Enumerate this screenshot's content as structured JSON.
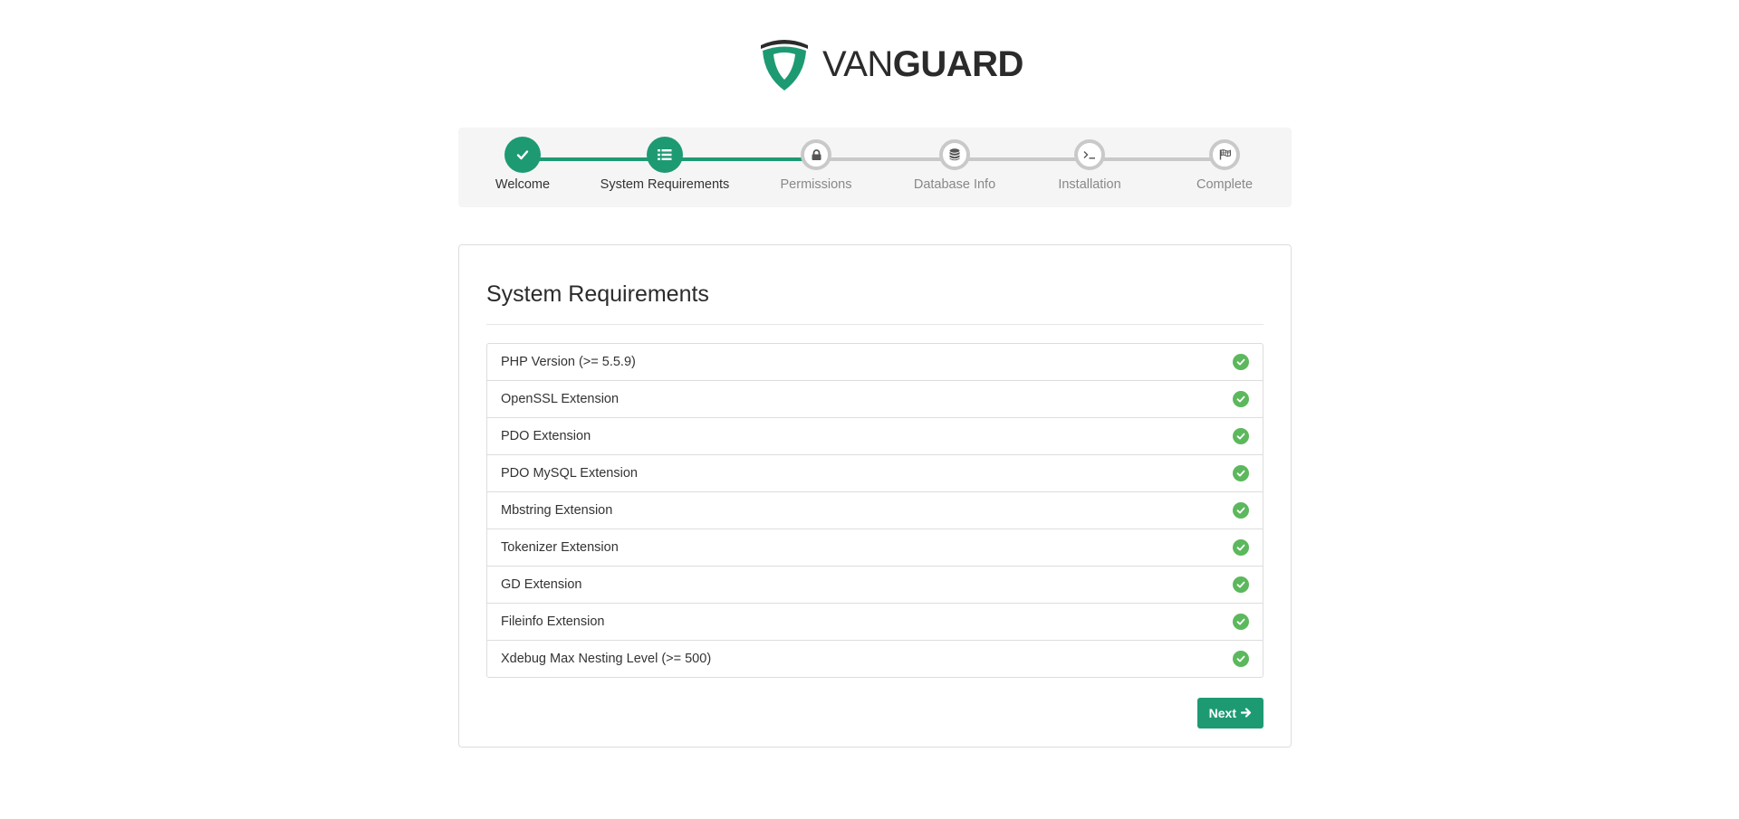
{
  "brand": {
    "name_thin": "VAN",
    "name_bold": "GUARD",
    "accent_color": "#1e9a73",
    "logo_icon": "shield-icon"
  },
  "wizard": {
    "steps": [
      {
        "label": "Welcome",
        "icon": "check-icon",
        "status": "done"
      },
      {
        "label": "System Requirements",
        "icon": "list-icon",
        "status": "current"
      },
      {
        "label": "Permissions",
        "icon": "lock-icon",
        "status": "pending"
      },
      {
        "label": "Database Info",
        "icon": "database-icon",
        "status": "pending"
      },
      {
        "label": "Installation",
        "icon": "terminal-icon",
        "status": "pending"
      },
      {
        "label": "Complete",
        "icon": "flag-icon",
        "status": "pending"
      }
    ]
  },
  "panel": {
    "title": "System Requirements",
    "requirements": [
      {
        "label": "PHP Version (>= 5.5.9)",
        "status": "ok"
      },
      {
        "label": "OpenSSL Extension",
        "status": "ok"
      },
      {
        "label": "PDO Extension",
        "status": "ok"
      },
      {
        "label": "PDO MySQL Extension",
        "status": "ok"
      },
      {
        "label": "Mbstring Extension",
        "status": "ok"
      },
      {
        "label": "Tokenizer Extension",
        "status": "ok"
      },
      {
        "label": "GD Extension",
        "status": "ok"
      },
      {
        "label": "Fileinfo Extension",
        "status": "ok"
      },
      {
        "label": "Xdebug Max Nesting Level (>= 500)",
        "status": "ok"
      }
    ],
    "next_label": "Next"
  },
  "colors": {
    "success": "#5cb85c",
    "pending": "#c9c9c9"
  }
}
